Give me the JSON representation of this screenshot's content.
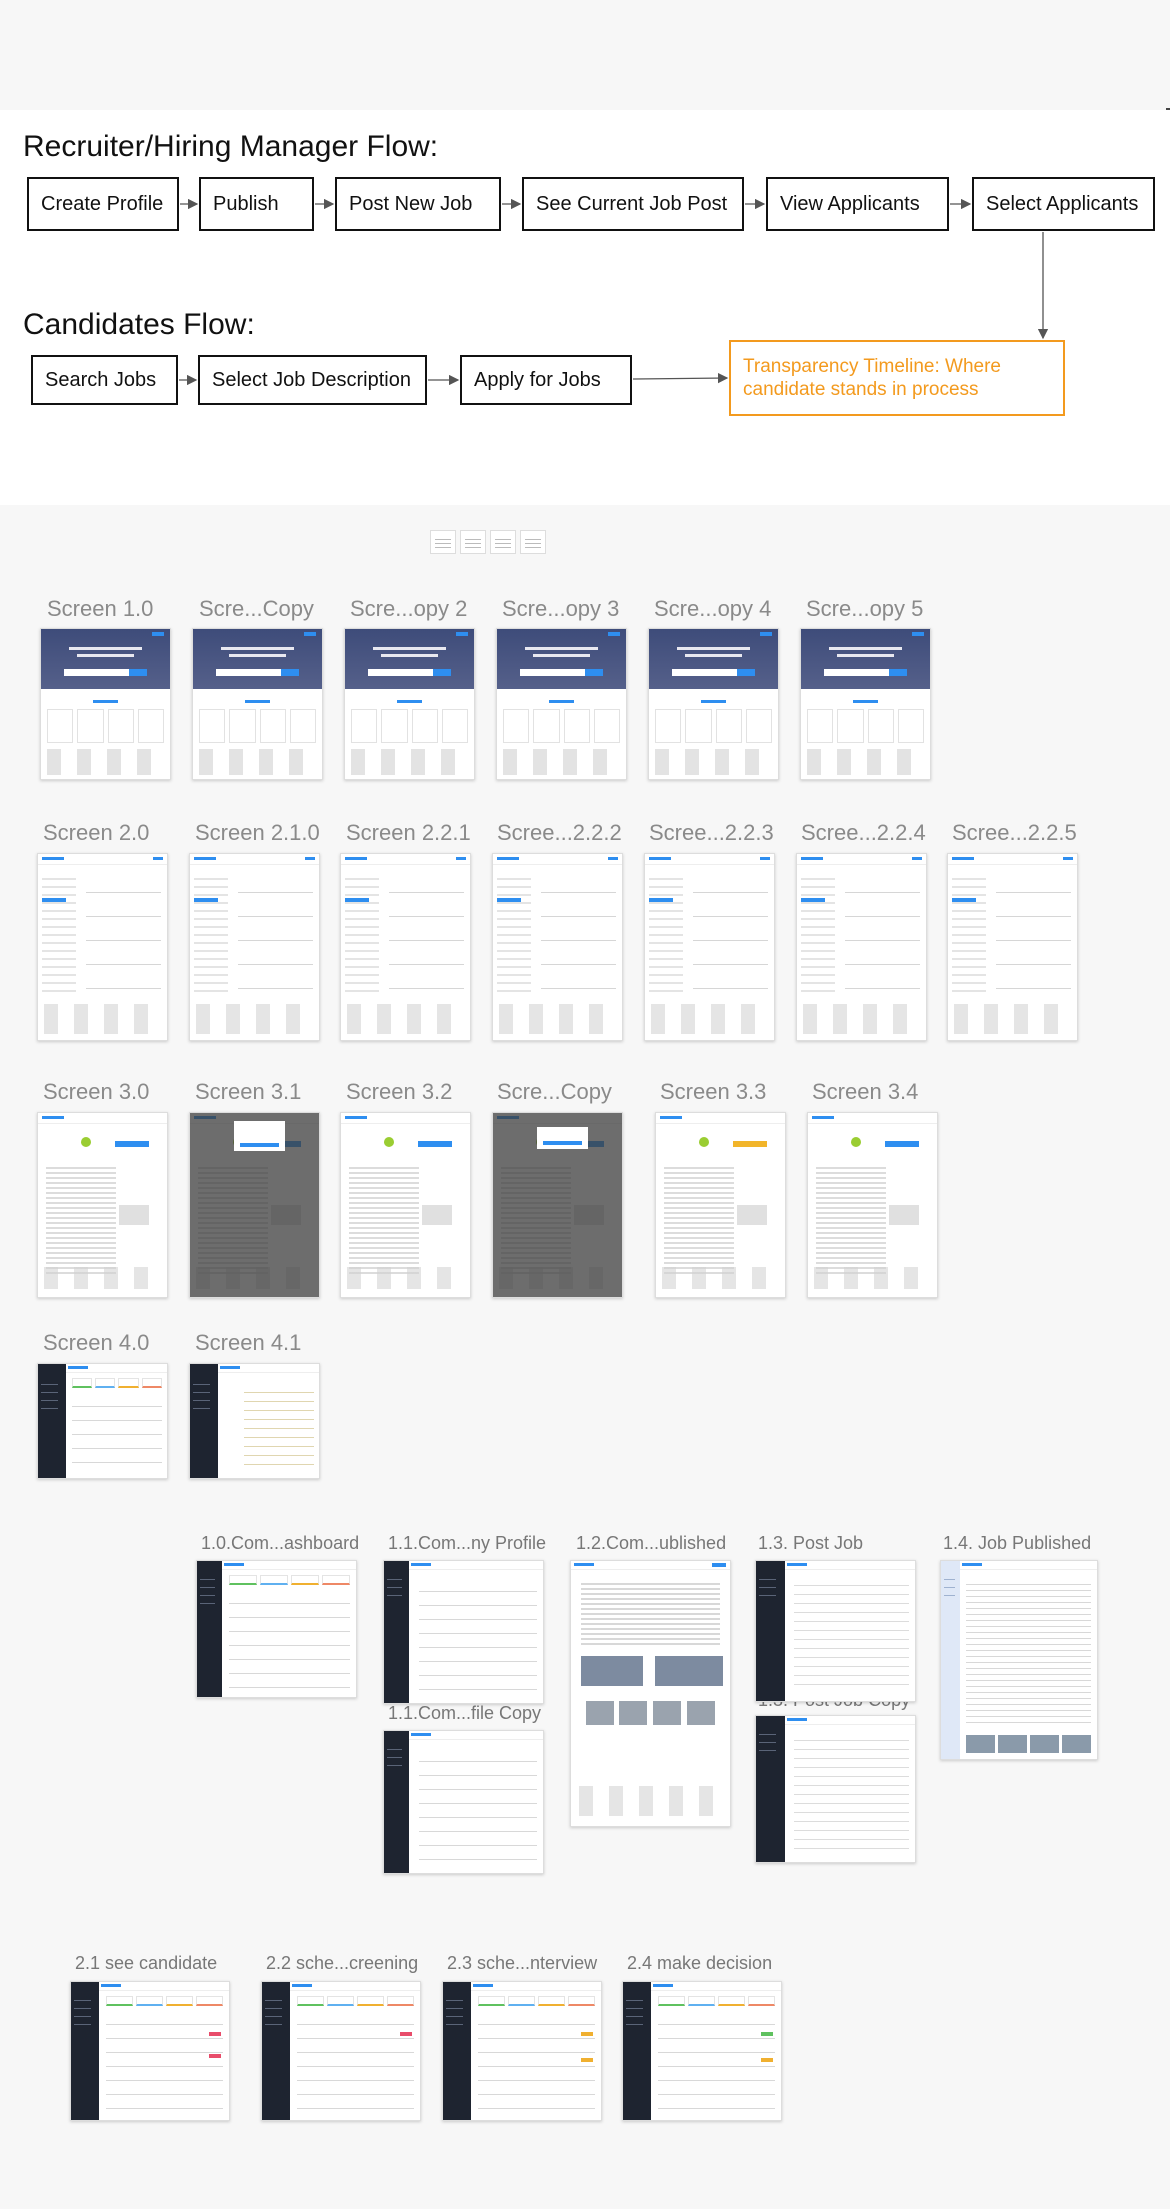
{
  "recruiter_flow": {
    "title": "Recruiter/Hiring Manager Flow:",
    "steps": [
      "Create Profile",
      "Publish",
      "Post New Job",
      "See Current Job Post",
      "View Applicants",
      "Select Applicants"
    ]
  },
  "candidate_flow": {
    "title": "Candidates Flow:",
    "steps": [
      "Search Jobs",
      "Select Job Description",
      "Apply for Jobs"
    ],
    "timeline": "Transparency Timeline: Where candidate stands in process"
  },
  "colors": {
    "accent": "#f39a1e",
    "link_blue": "#2e8ef0",
    "sidebar_dark": "#1e2430"
  },
  "screens_row1": [
    "Screen 1.0",
    "Scre...Copy",
    "Scre...opy 2",
    "Scre...opy 3",
    "Scre...opy 4",
    "Scre...opy 5"
  ],
  "screens_row2": [
    "Screen 2.0",
    "Screen 2.1.0",
    "Screen 2.2.1",
    "Scree...2.2.2",
    "Scree...2.2.3",
    "Scree...2.2.4",
    "Scree...2.2.5"
  ],
  "screens_row3": [
    "Screen 3.0",
    "Screen 3.1",
    "Screen 3.2",
    "Scre...Copy",
    "Screen 3.3",
    "Screen 3.4"
  ],
  "screens_row4": [
    "Screen 4.0",
    "Screen 4.1"
  ],
  "company_screens": {
    "dashboard": "1.0.Com...ashboard",
    "profile": "1.1.Com...ny Profile",
    "profile_copy": "1.1.Com...file Copy",
    "published": "1.2.Com...ublished",
    "post_job": "1.3. Post Job",
    "post_job_copy": "1.3. Post Job Copy",
    "job_published": "1.4. Job Published"
  },
  "candidate_screens": [
    "2.1 see candidate",
    "2.2 sche...creening",
    "2.3 sche...nterview",
    "2.4 make decision"
  ]
}
